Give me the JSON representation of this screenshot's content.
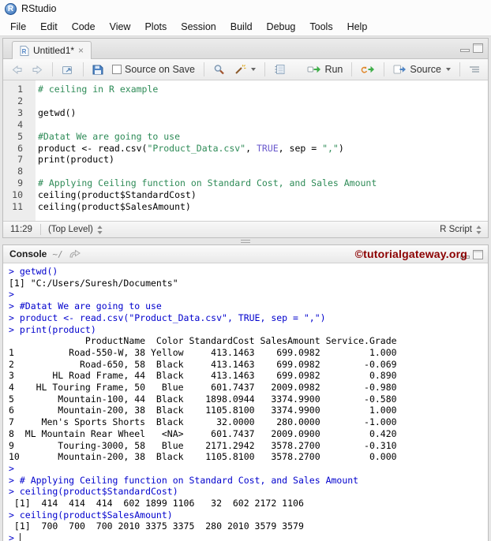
{
  "window": {
    "title": "RStudio"
  },
  "menu_items": [
    "File",
    "Edit",
    "Code",
    "View",
    "Plots",
    "Session",
    "Build",
    "Debug",
    "Tools",
    "Help"
  ],
  "editor": {
    "tab_label": "Untitled1*",
    "tab_close": "×",
    "toolbar": {
      "source_on_save": "Source on Save",
      "run": "Run",
      "source": "Source"
    },
    "code_lines": [
      {
        "n": "1",
        "seg": [
          {
            "c": "comment",
            "t": "# ceiling in R example"
          }
        ]
      },
      {
        "n": "2",
        "seg": []
      },
      {
        "n": "3",
        "seg": [
          {
            "c": "plain",
            "t": "getwd()"
          }
        ]
      },
      {
        "n": "4",
        "seg": []
      },
      {
        "n": "5",
        "seg": [
          {
            "c": "comment",
            "t": "#Datat We are going to use"
          }
        ]
      },
      {
        "n": "6",
        "seg": [
          {
            "c": "plain",
            "t": "product <- read.csv("
          },
          {
            "c": "string",
            "t": "\"Product_Data.csv\""
          },
          {
            "c": "plain",
            "t": ", "
          },
          {
            "c": "const",
            "t": "TRUE"
          },
          {
            "c": "plain",
            "t": ", sep = "
          },
          {
            "c": "string",
            "t": "\",\""
          },
          {
            "c": "plain",
            "t": ")"
          }
        ]
      },
      {
        "n": "7",
        "seg": [
          {
            "c": "plain",
            "t": "print(product)"
          }
        ]
      },
      {
        "n": "8",
        "seg": []
      },
      {
        "n": "9",
        "seg": [
          {
            "c": "comment",
            "t": "# Applying Ceiling function on Standard Cost, and Sales Amount"
          }
        ]
      },
      {
        "n": "10",
        "seg": [
          {
            "c": "plain",
            "t": "ceiling(product$StandardCost)"
          }
        ]
      },
      {
        "n": "11",
        "seg": [
          {
            "c": "plain",
            "t": "ceiling(product$SalesAmount)"
          }
        ]
      }
    ],
    "status": {
      "position": "11:29",
      "scope": "(Top Level)",
      "file_type": "R Script"
    }
  },
  "console": {
    "title": "Console",
    "working_dir": "~/",
    "watermark": "©tutorialgateway.org",
    "lines": [
      {
        "c": "in",
        "t": "> getwd()"
      },
      {
        "c": "out",
        "t": "[1] \"C:/Users/Suresh/Documents\""
      },
      {
        "c": "in",
        "t": "> "
      },
      {
        "c": "in",
        "t": "> #Datat We are going to use"
      },
      {
        "c": "in",
        "t": "> product <- read.csv(\"Product_Data.csv\", TRUE, sep = \",\")"
      },
      {
        "c": "in",
        "t": "> print(product)"
      },
      {
        "c": "out",
        "t": "              ProductName  Color StandardCost SalesAmount Service.Grade"
      },
      {
        "c": "out",
        "t": "1          Road-550-W, 38 Yellow     413.1463    699.0982         1.000"
      },
      {
        "c": "out",
        "t": "2            Road-650, 58  Black     413.1463    699.0982        -0.069"
      },
      {
        "c": "out",
        "t": "3       HL Road Frame, 44  Black     413.1463    699.0982         0.890"
      },
      {
        "c": "out",
        "t": "4    HL Touring Frame, 50   Blue     601.7437   2009.0982        -0.980"
      },
      {
        "c": "out",
        "t": "5        Mountain-100, 44  Black    1898.0944   3374.9900        -0.580"
      },
      {
        "c": "out",
        "t": "6        Mountain-200, 38  Black    1105.8100   3374.9900         1.000"
      },
      {
        "c": "out",
        "t": "7     Men's Sports Shorts  Black      32.0000    280.0000        -1.000"
      },
      {
        "c": "out",
        "t": "8  ML Mountain Rear Wheel   <NA>     601.7437   2009.0900         0.420"
      },
      {
        "c": "out",
        "t": "9        Touring-3000, 58   Blue    2171.2942   3578.2700        -0.310"
      },
      {
        "c": "out",
        "t": "10       Mountain-200, 38  Black    1105.8100   3578.2700         0.000"
      },
      {
        "c": "in",
        "t": "> "
      },
      {
        "c": "in",
        "t": "> # Applying Ceiling function on Standard Cost, and Sales Amount"
      },
      {
        "c": "in",
        "t": "> ceiling(product$StandardCost)"
      },
      {
        "c": "out",
        "t": " [1]  414  414  414  602 1899 1106   32  602 2172 1106"
      },
      {
        "c": "in",
        "t": "> ceiling(product$SalesAmount)"
      },
      {
        "c": "out",
        "t": " [1]  700  700  700 2010 3375 3375  280 2010 3579 3579"
      },
      {
        "c": "in",
        "t": "> ",
        "cursor": true
      }
    ]
  },
  "colors": {
    "console_input": "#0000cd",
    "comment": "#2e8b57",
    "string": "#2e8b57",
    "constant": "#6a5acd",
    "watermark_red": "#8b0000",
    "run_green": "#3fae49",
    "icon_blue": "#4f84c4"
  }
}
